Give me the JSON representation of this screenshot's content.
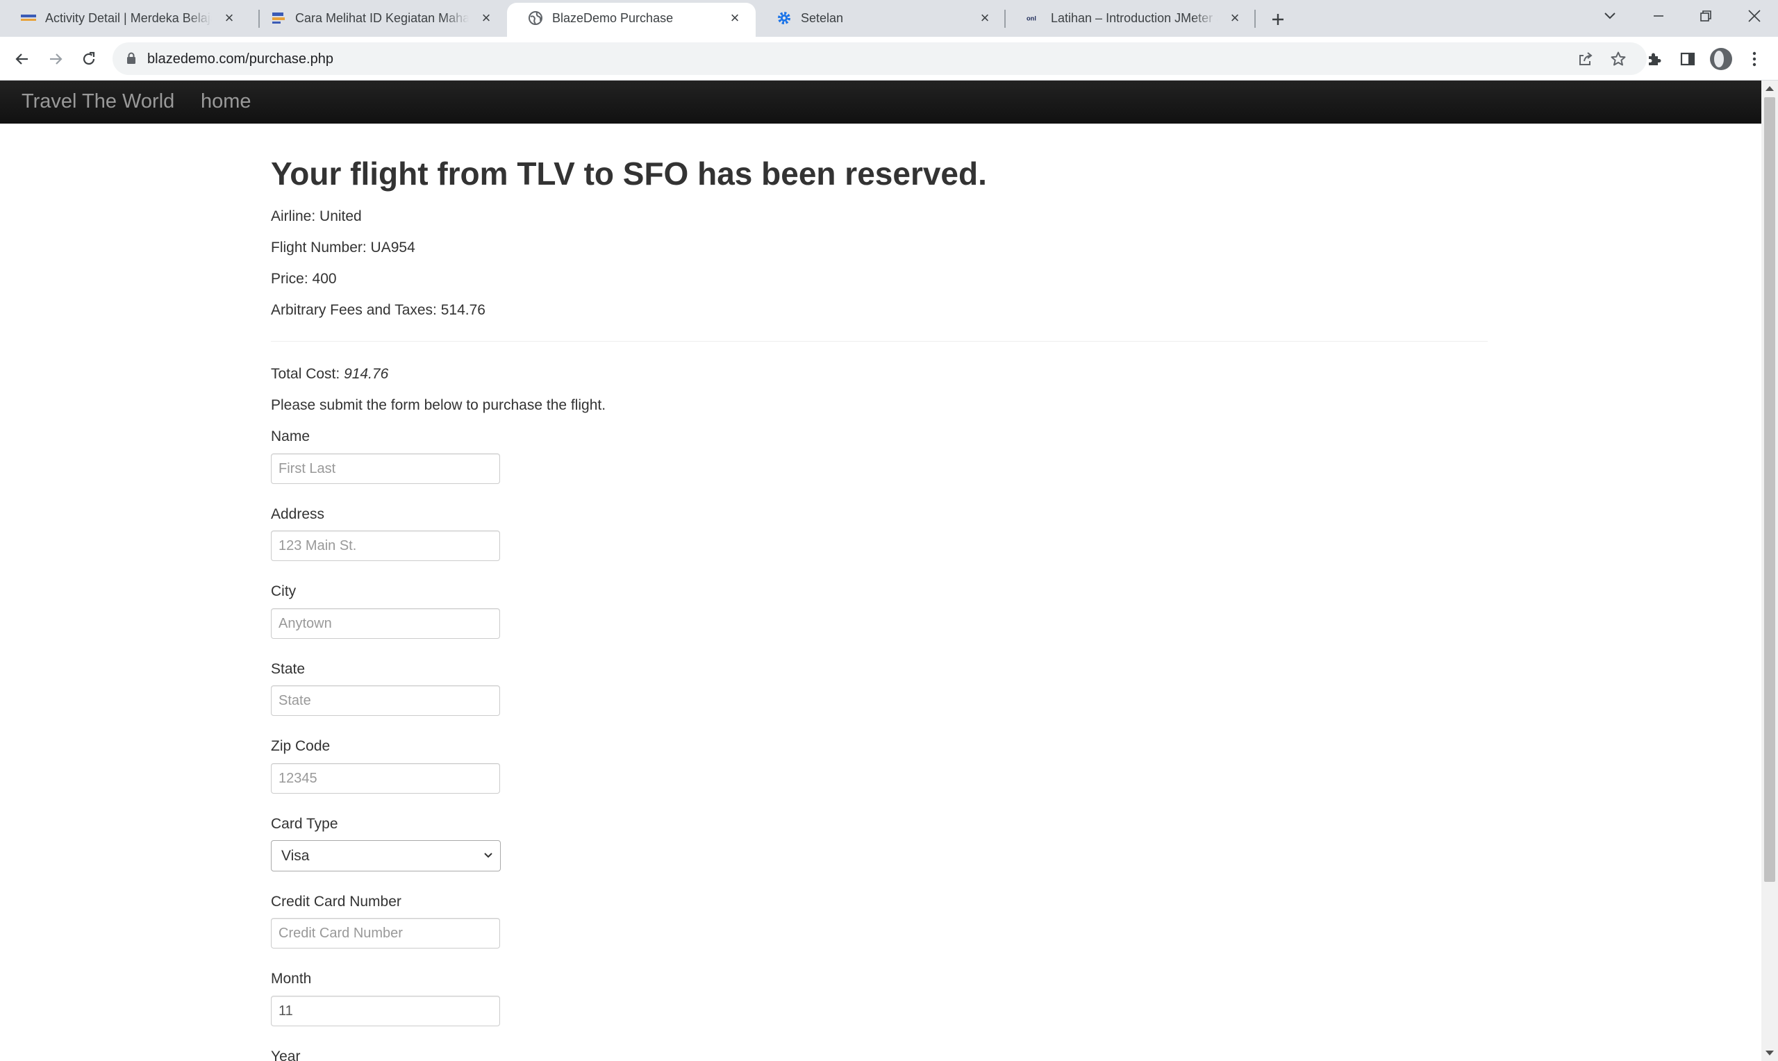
{
  "browser": {
    "tabs": [
      {
        "title": "Activity Detail | Merdeka Belajar",
        "icon": "kampus-merdeka-icon",
        "active": false
      },
      {
        "title": "Cara Melihat ID Kegiatan Mahasiswa",
        "icon": "kampus-merdeka-icon",
        "active": false
      },
      {
        "title": "BlazeDemo Purchase",
        "icon": "globe-icon",
        "active": true
      },
      {
        "title": "Setelan",
        "icon": "gear-icon",
        "active": false
      },
      {
        "title": "Latihan – Introduction JMeter and",
        "icon": "onl-icon",
        "active": false
      }
    ],
    "url": "blazedemo.com/purchase.php"
  },
  "page": {
    "navbar": {
      "brand": "Travel The World",
      "home_link": "home"
    },
    "heading": "Your flight from TLV to SFO has been reserved.",
    "details": {
      "airline": "Airline: United",
      "flight_number": "Flight Number: UA954",
      "price": "Price: 400",
      "fees": "Arbitrary Fees and Taxes: 514.76"
    },
    "total": {
      "label": "Total Cost:",
      "value": "914.76"
    },
    "instruction": "Please submit the form below to purchase the flight.",
    "form": {
      "name": {
        "label": "Name",
        "placeholder": "First Last"
      },
      "address": {
        "label": "Address",
        "placeholder": "123 Main St."
      },
      "city": {
        "label": "City",
        "placeholder": "Anytown"
      },
      "state": {
        "label": "State",
        "placeholder": "State"
      },
      "zip": {
        "label": "Zip Code",
        "placeholder": "12345"
      },
      "card_type": {
        "label": "Card Type",
        "selected": "Visa"
      },
      "card_number": {
        "label": "Credit Card Number",
        "placeholder": "Credit Card Number"
      },
      "month": {
        "label": "Month",
        "value": "11"
      },
      "year": {
        "label": "Year"
      }
    }
  },
  "colors": {
    "navbar_bg": "#1b1b1b",
    "navbar_text": "#999999",
    "text": "#333333",
    "tabstrip_bg": "#dee1e6",
    "omnibox_bg": "#f1f3f4"
  }
}
